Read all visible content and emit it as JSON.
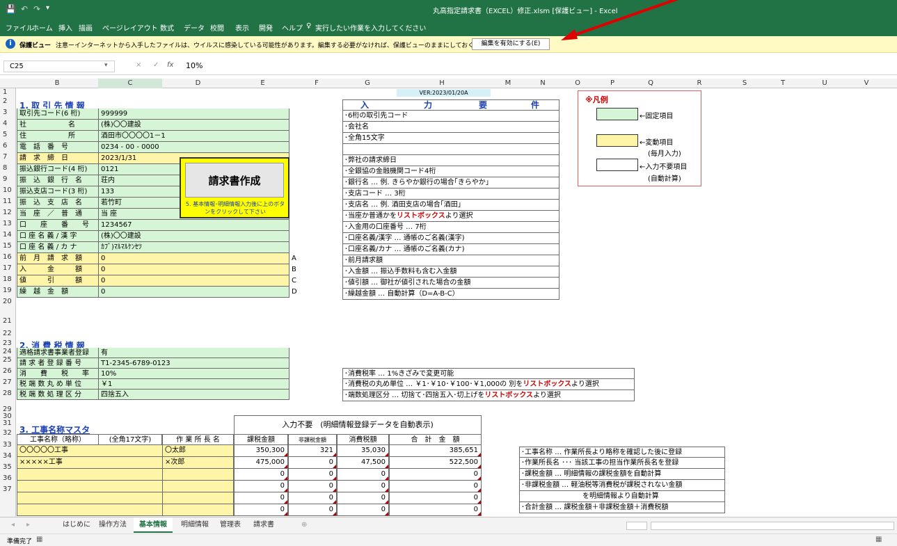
{
  "app": {
    "title": "丸高指定請求書（EXCEL）修正.xlsm [保護ビュー] - Excel",
    "qat": [
      "💾",
      "↶",
      "↷",
      "▾"
    ]
  },
  "ribbon_tabs": [
    "ファイル",
    "ホーム",
    "挿入",
    "描画",
    "ページレイアウト",
    "数式",
    "データ",
    "校閲",
    "表示",
    "開発",
    "ヘルプ"
  ],
  "tell_me": "実行したい作業を入力してください",
  "infobar": {
    "label": "保護ビュー",
    "message": "注意ーインターネットから入手したファイルは、ウイルスに感染している可能性があります。編集する必要がなければ、保護ビューのままにしておくことをお勧めします。",
    "button": "編集を有効にする(E)"
  },
  "formula": {
    "namebox": "C25",
    "fx": "fx",
    "value": "10%",
    "cancel": "×",
    "enter": "✓"
  },
  "columns": [
    "B",
    "C",
    "D",
    "E",
    "F",
    "G",
    "H",
    "M",
    "N",
    "O",
    "P",
    "Q",
    "R",
    "S",
    "T",
    "U",
    "V"
  ],
  "rows": [
    "1",
    "2",
    "3",
    "4",
    "5",
    "6",
    "7",
    "8",
    "9",
    "10",
    "11",
    "12",
    "13",
    "14",
    "15",
    "16",
    "17",
    "18",
    "19",
    "20",
    "21",
    "22",
    "23",
    "24",
    "25",
    "26",
    "27",
    "28",
    "29",
    "30",
    "31",
    "32",
    "33",
    "34",
    "35",
    "36",
    "37"
  ],
  "version": "VER:2023/01/20A",
  "sec1": "1. 取 引 先 情 報",
  "basic": [
    {
      "label": "取引先コード(6 桁)",
      "value": "999999",
      "cls": "g"
    },
    {
      "label": "社　　　　　　名",
      "value": "(株)〇〇建設",
      "cls": "g"
    },
    {
      "label": "住　　　　　　所",
      "value": "酒田市〇〇〇〇1－1",
      "cls": "g"
    },
    {
      "label": "電　話　番　号",
      "value": "0234 - 00 - 0000",
      "cls": "g"
    },
    {
      "label": "請　求　締　日",
      "value": "2023/1/31",
      "cls": "y"
    },
    {
      "label": "振込銀行コード(4 桁)",
      "value": "0121",
      "cls": "g"
    },
    {
      "label": "振　込　銀　行　名",
      "value": "荘内",
      "cls": "g"
    },
    {
      "label": "振込支店コード(3 桁)",
      "value": "133",
      "cls": "g"
    },
    {
      "label": "振　込　支　店　名",
      "value": "若竹町",
      "cls": "g"
    },
    {
      "label": "当　座　／　普　通",
      "value": "当 座",
      "cls": "g"
    },
    {
      "label": "口　　座　　番　　号",
      "value": "1234567",
      "cls": "g"
    },
    {
      "label": "口 座 名 義 / 漢 字",
      "value": "(株)〇〇建設",
      "cls": "g"
    },
    {
      "label": "口 座 名 義 / カ ナ",
      "value": "ｶﾌﾞ)ﾏﾙﾏﾙｹﾝｾﾂ",
      "cls": "g"
    },
    {
      "label": "前　月　請　求　額",
      "value": "0",
      "cls": "y",
      "letter": "A"
    },
    {
      "label": "入　　　金　　　額",
      "value": "0",
      "cls": "y",
      "letter": "B"
    },
    {
      "label": "値　　　引　　　額",
      "value": "0",
      "cls": "y",
      "letter": "C"
    },
    {
      "label": "繰　越　金　額",
      "value": "0",
      "cls": "g",
      "letter": "D"
    }
  ],
  "button": {
    "label": "請求書作成",
    "note": "5. 基本情報･明細情報入力後に上のボタンをクリックして下さい"
  },
  "req_header": {
    "a": "入",
    "b": "力",
    "c": "要",
    "d": "件"
  },
  "requirements": [
    "･6桁の取引先コード",
    "･会社名",
    "･全角15文字",
    "",
    "･弊社の請求締日",
    "･全銀協の金融機関コード4桁",
    "･銀行名 … 例. きらやか銀行の場合｢きらやか｣",
    "･支店コード … 3桁",
    "･支店名 … 例. 酒田支店の場合｢酒田｣",
    "･当座か普通かをリストボックスより選択",
    "･入金用の口座番号 … 7桁",
    "･口座名義/漢字 … 通帳のご名義(漢字)",
    "･口座名義/カナ … 通帳のご名義(カナ)",
    "･前月請求額",
    "･入金額 … 振込手数料も含む入金額",
    "･値引額 … 御社が値引された場合の金額",
    "･繰越金額 … 自動計算（D=A-B-C）"
  ],
  "legend": {
    "title": "※凡例",
    "fixed": "←固定項目",
    "variable": "←変動項目",
    "variable2": "(毎月入力)",
    "none": "←入力不要項目",
    "none2": "(自動計算)"
  },
  "sec2": "2. 消 費 税 情 報",
  "tax": [
    {
      "label": "適格請求書事業者登録",
      "value": "有",
      "cls": "g"
    },
    {
      "label": "請 求 者 登 録 番 号",
      "value": "T1-2345-6789-0123",
      "cls": "g"
    },
    {
      "label": "消　　費　　税　　率",
      "value": "10%",
      "cls": "g"
    },
    {
      "label": "税 端 数 丸 め 単 位",
      "value": "￥1",
      "cls": "g"
    },
    {
      "label": "税 端 数 処 理 区 分",
      "value": "四捨五入",
      "cls": "g"
    }
  ],
  "tax_req": [
    "･消費税率 … 1%きざみで変更可能",
    "･消費税の丸め単位 … ￥1･￥10･￥100･￥1,000の 別をリストボックスより選択",
    "･端数処理区分 … 切捨て･四捨五入･切上げをリストボックスより選択"
  ],
  "sec3": "3. 工事名称マスタ",
  "auto_header": "入力不要　(明細情報登録データを自動表示)",
  "koji_headers": [
    "工事名称（略称）",
    "(全角17文字)",
    "作 業 所 長 名",
    "課税金額",
    "非課税金額",
    "消費税額",
    "合　計　金　額"
  ],
  "koji_rows": [
    [
      "〇〇〇〇〇工事",
      "〇太郎",
      "350,300",
      "321",
      "35,030",
      "385,651"
    ],
    [
      "×××××工事",
      "×次郎",
      "475,000",
      "0",
      "47,500",
      "522,500"
    ],
    [
      "",
      "",
      "0",
      "0",
      "0",
      "0"
    ],
    [
      "",
      "",
      "0",
      "0",
      "0",
      "0"
    ],
    [
      "",
      "",
      "0",
      "0",
      "0",
      "0"
    ],
    [
      "",
      "",
      "0",
      "0",
      "0",
      "0"
    ]
  ],
  "koji_req": [
    "･工事名称 … 作業所長より略称を確認した後に登録",
    "･作業所長名 ･･･ 当該工事の担当作業所長名を登録",
    "･課税金額 … 明細情報の課税金額を自動計算",
    "･非課税金額 … 軽油税等消費税が課税されない金額",
    "を明細情報より自動計算",
    "･合計金額 … 課税金額＋非課税金額＋消費税額"
  ],
  "sheets": [
    "はじめに",
    "操作方法",
    "基本情報",
    "明細情報",
    "管理表",
    "請求書"
  ],
  "active_sheet": "基本情報",
  "status": "準備完了"
}
